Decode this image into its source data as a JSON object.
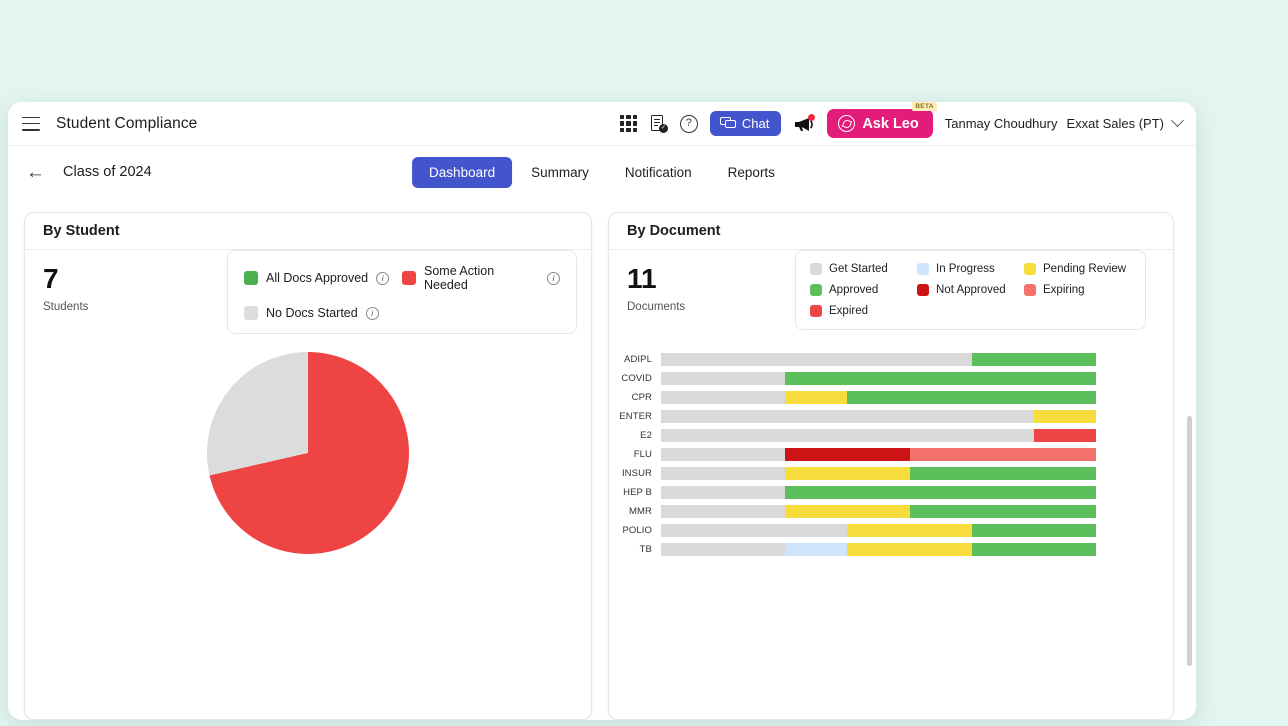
{
  "topbar": {
    "menu_icon": "hamburger-icon",
    "title": "Student Compliance",
    "apps_icon": "grid-apps-icon",
    "doc_icon": "document-check-icon",
    "help_icon": "question-circle-icon",
    "chat_label": "Chat",
    "chat_icon": "chat-bubbles-icon",
    "announce_icon": "megaphone-icon",
    "ask_leo_label": "Ask Leo",
    "ask_leo_badge": "BETA",
    "ask_leo_icon": "leo-swirl-icon",
    "user_name": "Tanmay Choudhury",
    "org_name": "Exxat Sales (PT)",
    "chevron_icon": "chevron-down-icon"
  },
  "subheader": {
    "back_icon": "back-arrow-icon",
    "breadcrumb": "Class of 2024",
    "tabs": [
      {
        "label": "Dashboard",
        "active": true
      },
      {
        "label": "Summary",
        "active": false
      },
      {
        "label": "Notification",
        "active": false
      },
      {
        "label": "Reports",
        "active": false
      }
    ]
  },
  "student_panel": {
    "title": "By Student",
    "count": "7",
    "count_label": "Students",
    "legend": [
      {
        "label": "All Docs Approved",
        "color": "#4caf50",
        "info": "i"
      },
      {
        "label": "Some Action Needed",
        "color": "#ef4444",
        "info": "i"
      },
      {
        "label": "No Docs Started",
        "color": "#dcdcdc",
        "info": "i"
      }
    ]
  },
  "document_panel": {
    "title": "By Document",
    "count": "11",
    "count_label": "Documents",
    "legend": [
      {
        "label": "Get Started",
        "color": "#d9d9d9"
      },
      {
        "label": "In Progress",
        "color": "#cfe4fb"
      },
      {
        "label": "Pending Review",
        "color": "#f7dd3c"
      },
      {
        "label": "Approved",
        "color": "#5cbf5c"
      },
      {
        "label": "Not Approved",
        "color": "#cd1414"
      },
      {
        "label": "Expiring",
        "color": "#f4726e"
      },
      {
        "label": "Expired",
        "color": "#ec4545"
      }
    ]
  },
  "chart_data": [
    {
      "type": "pie",
      "title": "By Student",
      "total": 7,
      "total_label": "Students",
      "labels": [
        "Some Action Needed",
        "No Docs Started",
        "All Docs Approved"
      ],
      "values": [
        5,
        2,
        0
      ],
      "colors": [
        "#ef4444",
        "#dcdcdc",
        "#4caf50"
      ],
      "legend_position": "top-right",
      "grid": false
    },
    {
      "type": "bar",
      "title": "By Document",
      "orientation": "horizontal",
      "stacked": true,
      "total": 11,
      "total_label": "Documents",
      "xlabel": "",
      "ylabel": "",
      "xlim": [
        0,
        7
      ],
      "grid": false,
      "legend_position": "top-right",
      "categories": [
        "ADIPL",
        "COVID",
        "CPR",
        "ENTER",
        "E2",
        "FLU",
        "INSUR",
        "HEP B",
        "MMR",
        "POLIO",
        "TB"
      ],
      "series": [
        {
          "name": "Get Started",
          "color": "#d9d9d9",
          "values": [
            5,
            2,
            2,
            6,
            6,
            2,
            2,
            2,
            2,
            3,
            2
          ]
        },
        {
          "name": "In Progress",
          "color": "#cfe4fb",
          "values": [
            0,
            0,
            0,
            0,
            0,
            0,
            0,
            0,
            0,
            0,
            1
          ]
        },
        {
          "name": "Pending Review",
          "color": "#f7dd3c",
          "values": [
            0,
            0,
            1,
            1,
            0,
            0,
            2,
            0,
            2,
            2,
            2
          ]
        },
        {
          "name": "Approved",
          "color": "#5cbf5c",
          "values": [
            2,
            5,
            4,
            0,
            0,
            0,
            3,
            5,
            3,
            2,
            2
          ]
        },
        {
          "name": "Not Approved",
          "color": "#cd1414",
          "values": [
            0,
            0,
            0,
            0,
            0,
            2,
            0,
            0,
            0,
            0,
            0
          ]
        },
        {
          "name": "Expiring",
          "color": "#f4726e",
          "values": [
            0,
            0,
            0,
            0,
            0,
            3,
            0,
            0,
            0,
            0,
            0
          ]
        },
        {
          "name": "Expired",
          "color": "#ec4545",
          "values": [
            0,
            0,
            0,
            0,
            1,
            0,
            0,
            0,
            0,
            0,
            0
          ]
        }
      ]
    }
  ]
}
